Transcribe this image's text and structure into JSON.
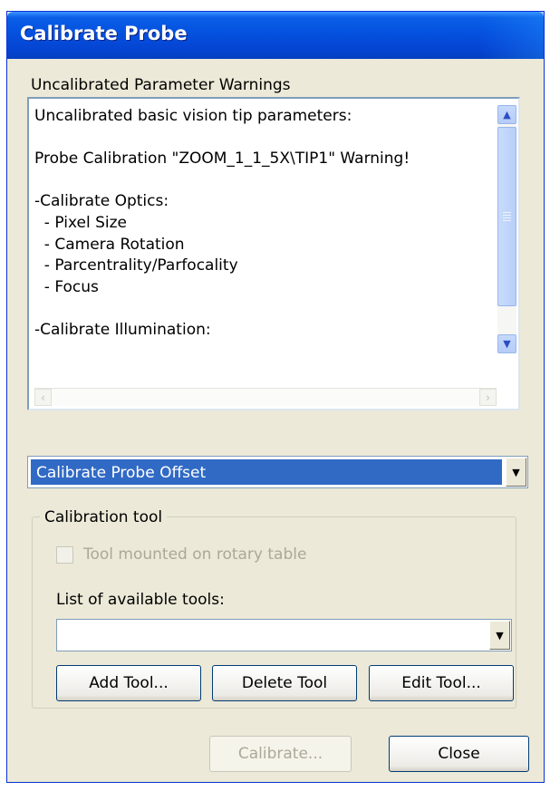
{
  "window": {
    "title": "Calibrate Probe"
  },
  "warnings": {
    "heading": "Uncalibrated Parameter Warnings",
    "lines": [
      "Uncalibrated basic vision tip parameters:",
      "",
      "Probe Calibration \"ZOOM_1_1_5X\\TIP1\" Warning!",
      "",
      "-Calibrate Optics:",
      "  - Pixel Size",
      "  - Camera Rotation",
      "  - Parcentrality/Parfocality",
      "  - Focus",
      "",
      "-Calibrate Illumination:"
    ]
  },
  "mode_select": {
    "selected": "Calibrate Probe Offset"
  },
  "calibration_tool": {
    "group_label": "Calibration tool",
    "rotary_checkbox_label": "Tool mounted on rotary table",
    "rotary_checked": false,
    "tools_label": "List of available tools:",
    "tools_selected": "",
    "add_label": "Add Tool...",
    "delete_label": "Delete Tool",
    "edit_label": "Edit Tool..."
  },
  "footer": {
    "calibrate_label": "Calibrate...",
    "close_label": "Close"
  },
  "colors": {
    "titlebar": "#0553e1",
    "selection": "#316ac5",
    "dialog_bg": "#ece9d8"
  },
  "icons": {
    "scroll_up": "chevron-up-icon",
    "scroll_down": "chevron-down-icon",
    "dropdown": "triangle-down-icon"
  }
}
